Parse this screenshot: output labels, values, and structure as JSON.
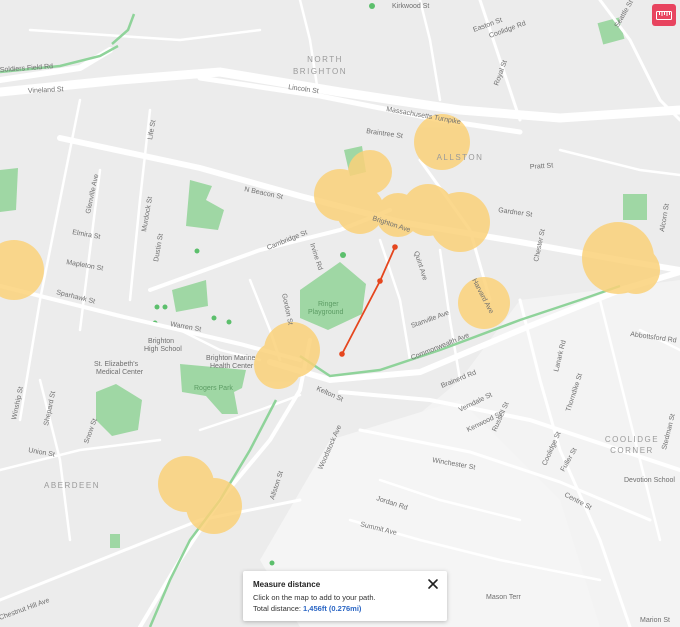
{
  "neighborhoods": [
    {
      "id": "north-brighton",
      "lines": [
        "NORTH",
        "BRIGHTON"
      ]
    },
    {
      "id": "allston",
      "lines": [
        "ALLSTON"
      ]
    },
    {
      "id": "aberdeen",
      "lines": [
        "ABERDEEN"
      ]
    },
    {
      "id": "coolidge-corner",
      "lines": [
        "COOLIDGE",
        "CORNER"
      ]
    }
  ],
  "streets": {
    "lincoln": "Lincoln St",
    "vineland": "Vineland St",
    "mass_turnpike": "Massachusetts Turnpike",
    "soldiers_field": "Soldiers Field Rd",
    "braintree": "Braintree St",
    "n_beacon": "N Beacon St",
    "cambridge": "Cambridge St",
    "gardner": "Gardner St",
    "pratt": "Pratt St",
    "easton": "Easton St",
    "coolidge_rd": "Coolidge Rd",
    "royal": "Royal St",
    "seattle": "Seattle St",
    "life": "Life St",
    "glenville": "Glenville Ave",
    "murdock": "Murdock St",
    "elmira": "Elmira St",
    "dustin": "Dustin St",
    "mapleton": "Mapleton St",
    "sparhawk": "Sparhawk St",
    "warren": "Warren St",
    "irvine": "Irvine Rd",
    "quint": "Quint Ave",
    "brighton_ave": "Brighton Ave",
    "chester": "Chester St",
    "alcorn": "Alcorn St",
    "harvard_ave": "Harvard Ave",
    "gordon": "Gordon St",
    "stanville": "Stanville Ave",
    "commonwealth": "Commonwealth Ave",
    "brainerd": "Brainerd Rd",
    "kelton": "Kelton St",
    "abbottsford": "Abbottsford Rd",
    "winship": "Winship St",
    "shepard": "Shepard St",
    "snow": "Snow St",
    "union": "Union St",
    "woodstock": "Woodstock Ave",
    "allston_st": "Allston St",
    "verndale": "Verndale St",
    "kenwood": "Kenwood St",
    "russell": "Russell St",
    "lanark": "Lanark Rd",
    "thorndike": "Thorndike St",
    "stedman": "Stedman St",
    "winchester": "Winchester St",
    "coolidge_st": "Coolidge St",
    "fuller": "Fuller St",
    "centre": "Centre St",
    "devotion": "Devotion School",
    "jordan": "Jordan Rd",
    "summit": "Summit Ave",
    "mason": "Mason Terr",
    "marion": "Marion St",
    "chestnut_hill": "Chestnut Hill Ave",
    "kenwood_top": "Kirkwood St"
  },
  "pois": {
    "st_elizabeths": [
      "St. Elizabeth's",
      "Medical Center"
    ],
    "brighton_hs": [
      "Brighton",
      "High School"
    ],
    "brighton_marine": [
      "Brighton Marine",
      "Health Center"
    ],
    "ringer_park": [
      "Ringer",
      "Playground"
    ],
    "rogers_park": "Rogers Park"
  },
  "measure_tool": {
    "icon": "ruler-icon",
    "title": "Measure distance",
    "instruction": "Click on the map to add to your path.",
    "total_label": "Total distance:",
    "total_value": "1,456ft (0.276mi)",
    "close_icon": "close-icon"
  },
  "colors": {
    "map_background": "#ececec",
    "road": "#ffffff",
    "park": "#9fd7a4",
    "path": "#8fd39a",
    "highlight": "#fbd27a",
    "measure_line": "#e5461e",
    "tool_accent": "#e8445f",
    "distance_text": "#2b66c4"
  }
}
